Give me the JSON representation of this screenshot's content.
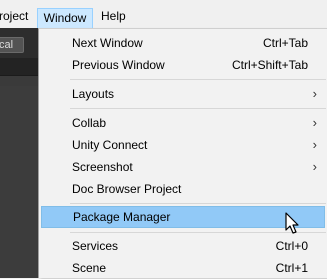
{
  "menubar": {
    "project_label": "roject",
    "window_label": "Window",
    "help_label": "Help"
  },
  "editor": {
    "local_button_label": "cal"
  },
  "window_menu": {
    "items": [
      {
        "label": "Next Window",
        "shortcut": "Ctrl+Tab"
      },
      {
        "label": "Previous Window",
        "shortcut": "Ctrl+Shift+Tab"
      },
      {
        "label": "Layouts",
        "submenu_icon": "chevron-right-icon"
      },
      {
        "label": "Collab",
        "submenu_icon": "chevron-right-icon"
      },
      {
        "label": "Unity Connect",
        "submenu_icon": "chevron-right-icon"
      },
      {
        "label": "Screenshot",
        "submenu_icon": "chevron-right-icon"
      },
      {
        "label": "Doc Browser Project"
      },
      {
        "label": "Package Manager",
        "state": "highlighted"
      },
      {
        "label": "Services",
        "shortcut": "Ctrl+0"
      },
      {
        "label": "Scene",
        "shortcut": "Ctrl+1"
      }
    ],
    "submenu_arrow": "›",
    "highlight_color": "#91c9f7"
  },
  "colors": {
    "menubar_bg": "#f0f0f0",
    "menu_bg": "#f2f2f2",
    "editor_dark": "#3a3a3a"
  }
}
